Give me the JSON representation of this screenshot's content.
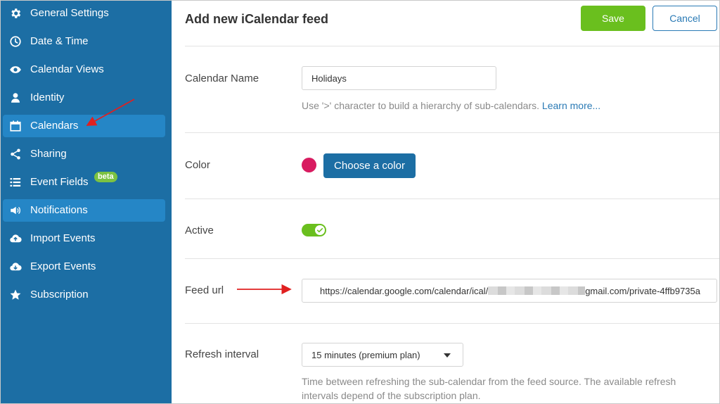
{
  "sidebar": {
    "items": [
      {
        "label": "General Settings",
        "icon": "gear-icon",
        "active": false
      },
      {
        "label": "Date & Time",
        "icon": "clock-icon",
        "active": false
      },
      {
        "label": "Calendar Views",
        "icon": "eye-icon",
        "active": false
      },
      {
        "label": "Identity",
        "icon": "user-icon",
        "active": false
      },
      {
        "label": "Calendars",
        "icon": "calendar-icon",
        "active": true
      },
      {
        "label": "Sharing",
        "icon": "share-icon",
        "active": false
      },
      {
        "label": "Event Fields",
        "icon": "list-icon",
        "active": false,
        "badge": "beta"
      },
      {
        "label": "Notifications",
        "icon": "megaphone-icon",
        "active": true
      },
      {
        "label": "Import Events",
        "icon": "cloud-upload-icon",
        "active": false
      },
      {
        "label": "Export Events",
        "icon": "cloud-download-icon",
        "active": false
      },
      {
        "label": "Subscription",
        "icon": "star-icon",
        "active": false
      }
    ]
  },
  "header": {
    "title": "Add new iCalendar feed",
    "save_label": "Save",
    "cancel_label": "Cancel"
  },
  "form": {
    "calendar_name": {
      "label": "Calendar Name",
      "value": "Holidays",
      "hint": "Use '>' character to build a hierarchy of sub-calendars.",
      "hint_link": "Learn more..."
    },
    "color": {
      "label": "Color",
      "value": "#d81b60",
      "button_label": "Choose a color"
    },
    "active": {
      "label": "Active",
      "checked": true
    },
    "feed_url": {
      "label": "Feed url",
      "value_prefix": "https://calendar.google.com/calendar/ical/",
      "value_suffix": "gmail.com/private-4ffb9735a"
    },
    "refresh_interval": {
      "label": "Refresh interval",
      "selected": "15 minutes (premium plan)",
      "hint_line1": "Time between refreshing the sub-calendar from the feed source. The available refresh",
      "hint_line2": "intervals depend of the subscription plan."
    }
  },
  "colors": {
    "sidebar_bg": "#1c6ea4",
    "sidebar_active": "#2586c6",
    "save_green": "#6abf1e",
    "accent_blue": "#2a7ab5",
    "annotation_red": "#e02020"
  }
}
